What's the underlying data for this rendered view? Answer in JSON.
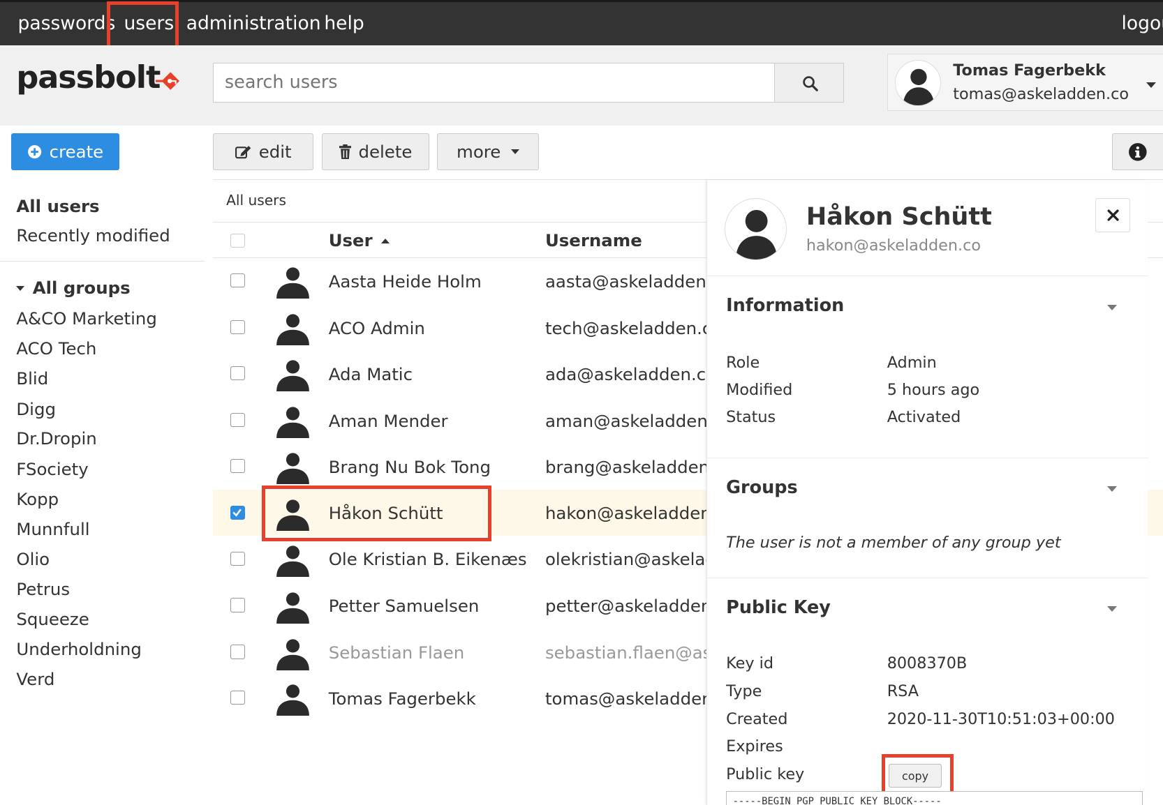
{
  "nav": {
    "items": [
      "passwords",
      "users",
      "administration",
      "help"
    ],
    "logout": "logou"
  },
  "brand": {
    "logo_text": "passbolt"
  },
  "search": {
    "placeholder": "search users"
  },
  "profile": {
    "name": "Tomas Fagerbekk",
    "email": "tomas@askeladden.co"
  },
  "toolbar": {
    "create_label": "create",
    "edit_label": "edit",
    "delete_label": "delete",
    "more_label": "more"
  },
  "sidebar": {
    "filters": [
      "All users",
      "Recently modified"
    ],
    "groups_title": "All groups",
    "groups": [
      "A&CO Marketing",
      "ACO Tech",
      "Blid",
      "Digg",
      "Dr.Dropin",
      "FSociety",
      "Kopp",
      "Munnfull",
      "Olio",
      "Petrus",
      "Squeeze",
      "Underholdning",
      "Verd"
    ]
  },
  "grid": {
    "breadcrumb": "All users",
    "columns": {
      "user": "User",
      "username": "Username"
    },
    "rows": [
      {
        "name": "Aasta Heide Holm",
        "username": "aasta@askeladden.co",
        "selected": false
      },
      {
        "name": "ACO Admin",
        "username": "tech@askeladden.co",
        "selected": false
      },
      {
        "name": "Ada Matic",
        "username": "ada@askeladden.co",
        "selected": false
      },
      {
        "name": "Aman Mender",
        "username": "aman@askeladden.co",
        "selected": false
      },
      {
        "name": "Brang Nu Bok Tong",
        "username": "brang@askeladden.co",
        "selected": false
      },
      {
        "name": "Håkon Schütt",
        "username": "hakon@askeladden.co",
        "selected": true
      },
      {
        "name": "Ole Kristian B. Eikenæs",
        "username": "olekristian@askeladden.co",
        "selected": false
      },
      {
        "name": "Petter Samuelsen",
        "username": "petter@askeladden.co",
        "selected": false
      },
      {
        "name": "Sebastian Flaen",
        "username": "sebastian.flaen@askeladden.co",
        "selected": false,
        "inactive": true
      },
      {
        "name": "Tomas Fagerbekk",
        "username": "tomas@askeladden.co",
        "selected": false
      }
    ]
  },
  "details": {
    "name": "Håkon Schütt",
    "email": "hakon@askeladden.co",
    "information": {
      "title": "Information",
      "role_label": "Role",
      "role": "Admin",
      "modified_label": "Modified",
      "modified": "5 hours ago",
      "status_label": "Status",
      "status": "Activated"
    },
    "groups": {
      "title": "Groups",
      "empty_text": "The user is not a member of any group yet"
    },
    "public_key": {
      "title": "Public Key",
      "key_id_label": "Key id",
      "key_id": "8008370B",
      "type_label": "Type",
      "type": "RSA",
      "created_label": "Created",
      "created": "2020-11-30T10:51:03+00:00",
      "expires_label": "Expires",
      "expires": "",
      "public_key_label": "Public key",
      "copy_label": "copy",
      "armor_start": "-----BEGIN PGP PUBLIC KEY BLOCK-----"
    }
  },
  "colors": {
    "accent": "#2d8de0",
    "highlight": "#e8412b",
    "brand_red": "#e8412b",
    "nav_bg": "#333333",
    "selected_row": "#fdf8e8"
  }
}
